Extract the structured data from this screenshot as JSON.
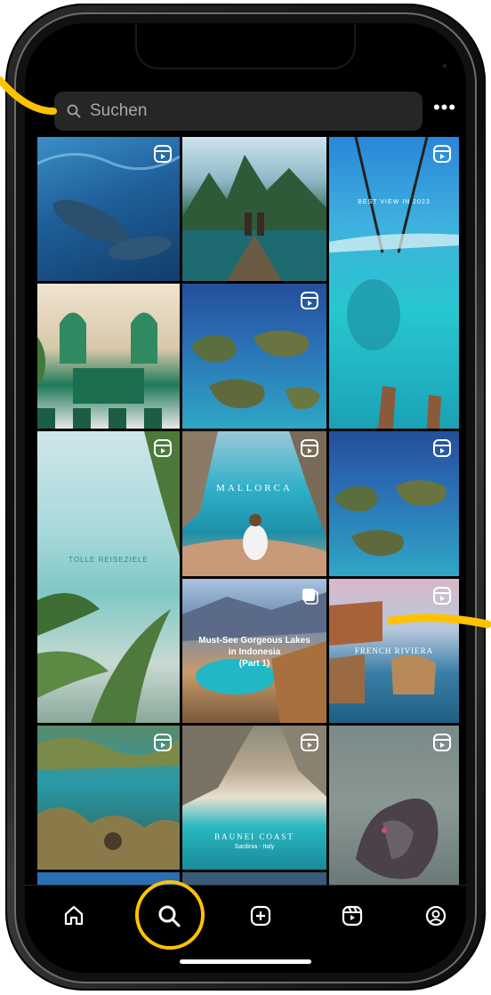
{
  "search": {
    "placeholder": "Suchen"
  },
  "header": {
    "more_label": "•••"
  },
  "tiles": {
    "best_view": "BEST VIEW IN 2023",
    "mallorca": "MALLORCA",
    "tolle_reiseziele": "TOLLE REISEZIELE",
    "lakes_line1": "Must-See Gorgeous Lakes",
    "lakes_line2": "in Indonesia",
    "lakes_line3": "(Part 1)",
    "french_riviera": "FRENCH RIVIERA",
    "baunei_coast": "BAUNEI COAST",
    "baunei_sub": "Sardinia - Italy"
  },
  "nav": {
    "items": [
      "home",
      "search",
      "create",
      "reels",
      "profile"
    ],
    "active": "search"
  },
  "colors": {
    "accent_highlight": "#ffc200",
    "background": "#000000",
    "search_bg": "#262626"
  }
}
